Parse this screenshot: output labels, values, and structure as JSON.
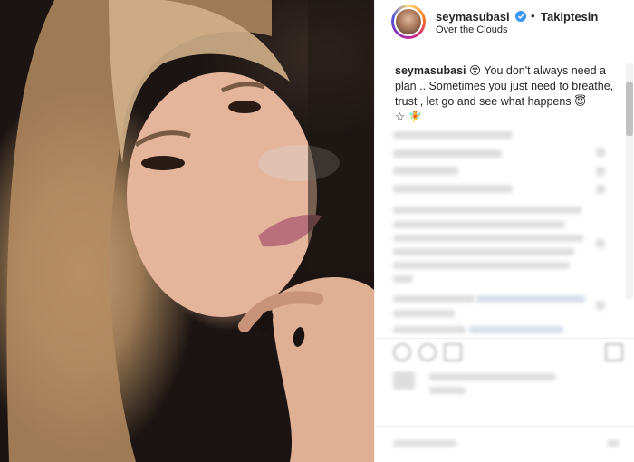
{
  "post": {
    "image_alt": "Selfie of a woman with blonde hair resting chin on hand",
    "author": {
      "username": "seymasubasi",
      "verified": true,
      "follow_label": "Takiptesin",
      "location": "Over the Clouds"
    },
    "caption": {
      "username": "seymasubasi",
      "text": "You don't always need a plan .. Sometimes you just need to breathe, trust , let go and see what happens",
      "emoji_lead": "😵",
      "emoji_trail": "😇",
      "emoji_end": "☆ 🧚"
    }
  },
  "colors": {
    "text": "#262626",
    "divider": "#efefef",
    "verified": "#3897f0"
  },
  "icons": [
    "verified-icon",
    "heart-icon",
    "comment-icon",
    "share-icon",
    "bookmark-icon"
  ]
}
